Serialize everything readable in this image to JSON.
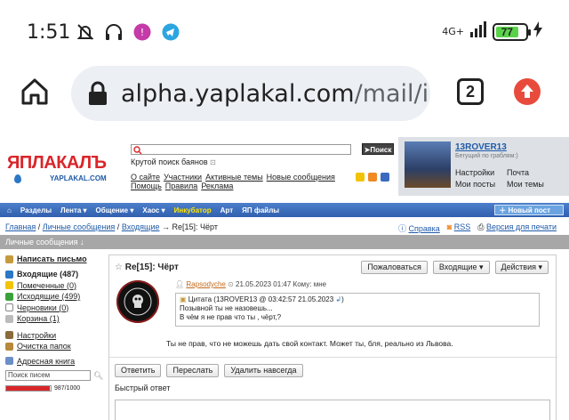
{
  "status": {
    "time": "1:51",
    "network": "4G+",
    "battery": "77",
    "battery_level": 0.77,
    "icons": [
      "mute-off-icon",
      "headphones-icon",
      "app-icon",
      "telegram-icon"
    ]
  },
  "browser": {
    "url_main": "alpha.yaplakal.com",
    "url_path": "/mail/inb",
    "tab_count": "2"
  },
  "header": {
    "logo": "ЯПЛАКАЛЪ",
    "logo_sub": "YAPLAKAL.COM",
    "search_button": "Поиск",
    "search_hint": "Крутой поиск баянов",
    "links_row1": [
      "О сайте",
      "Участники",
      "Активные темы",
      "Новые сообщения"
    ],
    "links_row2": [
      "Помощь",
      "Правила",
      "Реклама"
    ]
  },
  "user": {
    "name": "13ROVER13",
    "status": "Бегущий по граблям:)",
    "menu": [
      "Настройки",
      "Почта",
      "Мои посты",
      "Мои темы"
    ]
  },
  "nav": {
    "items": [
      "Разделы",
      "Лента ▾",
      "Общение ▾",
      "Хаос ▾",
      "Инкубатор",
      "Арт",
      "ЯП файлы"
    ],
    "new_post": "Новый пост"
  },
  "breadcrumb": {
    "home": "Главная",
    "personal": "Личные сообщения",
    "inbox": "Входящие",
    "current": "Re[15]: Чёрт"
  },
  "right_links": [
    "Справка",
    "RSS",
    "Версия для печати"
  ],
  "section_title": "Личные сообщения ↓",
  "sidebar": {
    "compose": "Написать письмо",
    "folders": [
      {
        "label": "Входящие (487)",
        "bold": true
      },
      {
        "label": "Помеченные (0)",
        "bold": false
      },
      {
        "label": "Исходящие (499)",
        "bold": false
      },
      {
        "label": "Черновики (0)",
        "bold": false
      },
      {
        "label": "Корзина (1)",
        "bold": false
      }
    ],
    "settings": "Настройки",
    "clean": "Очистка папок",
    "addressbook": "Адресная книга",
    "search_placeholder": "Поиск писем",
    "quota": "987/1000",
    "quota_level": 0.987
  },
  "message": {
    "subject": "Re[15]: Чёрт",
    "buttons": [
      "Пожаловаться",
      "Входящие ▾",
      "Действия ▾"
    ],
    "author": "Rapsodyche",
    "date": "21.05.2023 01:47 Кому: мне",
    "quote_header": "Цитата (13ROVER13 @ 03:42:57 21.05.2023",
    "quote_lines": [
      "Позывной ты не назовешь...",
      "В чём я не прав что ты , чёрт,?"
    ],
    "body": "Ты не прав, что не можешь дать свой контакт. Может ты, бля, реально из Львова.",
    "reply_buttons": [
      "Ответить",
      "Переслать",
      "Удалить навсегда"
    ],
    "quick_reply": "Быстрый ответ"
  }
}
